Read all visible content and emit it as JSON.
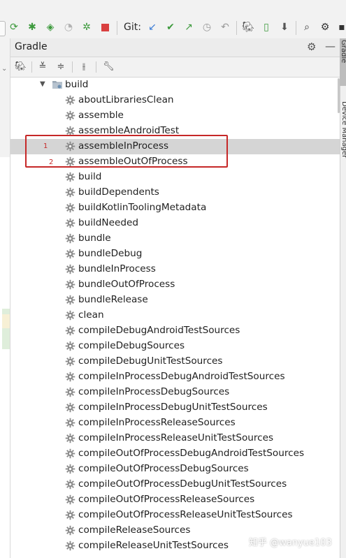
{
  "toolbar": {
    "git_label": "Git:",
    "icons": [
      "rerun-icon",
      "debug-icon",
      "coverage-icon",
      "profile-icon",
      "attach-debugger-icon",
      "stop-icon",
      "git-update-icon",
      "git-commit-icon",
      "git-push-icon",
      "git-history-icon",
      "git-rollback-icon",
      "sync-gradle-icon",
      "device-manager-icon",
      "sdk-manager-icon",
      "search-icon",
      "settings-icon"
    ],
    "colors": {
      "green": "#3d9a3d",
      "red": "#d94040",
      "blue": "#3a7bd5",
      "gray": "#9a9a9a"
    }
  },
  "panel": {
    "title": "Gradle",
    "tools": [
      "gradle-elephant-icon",
      "expand-all-icon",
      "collapse-all-icon",
      "toggle-offline-icon",
      "build-tools-icon"
    ]
  },
  "tree": {
    "root": "build",
    "tasks": [
      "aboutLibrariesClean",
      "assemble",
      "assembleAndroidTest",
      "assembleInProcess",
      "assembleOutOfProcess",
      "build",
      "buildDependents",
      "buildKotlinToolingMetadata",
      "buildNeeded",
      "bundle",
      "bundleDebug",
      "bundleInProcess",
      "bundleOutOfProcess",
      "bundleRelease",
      "clean",
      "compileDebugAndroidTestSources",
      "compileDebugSources",
      "compileDebugUnitTestSources",
      "compileInProcessDebugAndroidTestSources",
      "compileInProcessDebugSources",
      "compileInProcessDebugUnitTestSources",
      "compileInProcessReleaseSources",
      "compileInProcessReleaseUnitTestSources",
      "compileOutOfProcessDebugAndroidTestSources",
      "compileOutOfProcessDebugSources",
      "compileOutOfProcessDebugUnitTestSources",
      "compileOutOfProcessReleaseSources",
      "compileOutOfProcessReleaseUnitTestSources",
      "compileReleaseSources",
      "compileReleaseUnitTestSources"
    ],
    "selected_index": 3
  },
  "annotations": {
    "one": "1",
    "two": "2"
  },
  "right_tabs": {
    "gradle": "Gradle",
    "device_manager": "Device Manager"
  },
  "watermark": "知乎 @wanyue103"
}
